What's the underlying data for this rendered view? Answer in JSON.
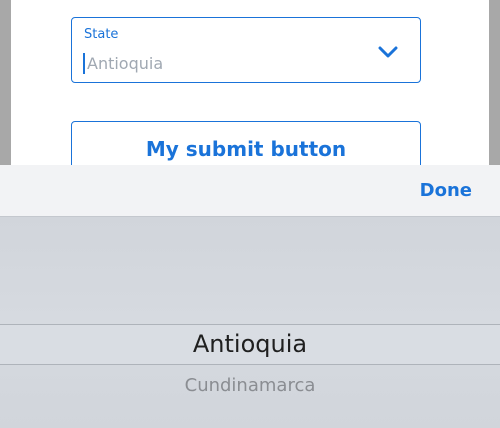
{
  "form": {
    "state_field": {
      "label": "State",
      "value": "Antioquia"
    },
    "submit_label": "My submit button"
  },
  "picker": {
    "done_label": "Done",
    "selected_option": "Antioquia",
    "next_option": "Cundinamarca"
  },
  "icons": {
    "chevron": "chevron-down-icon"
  },
  "colors": {
    "accent": "#1a73d9"
  }
}
